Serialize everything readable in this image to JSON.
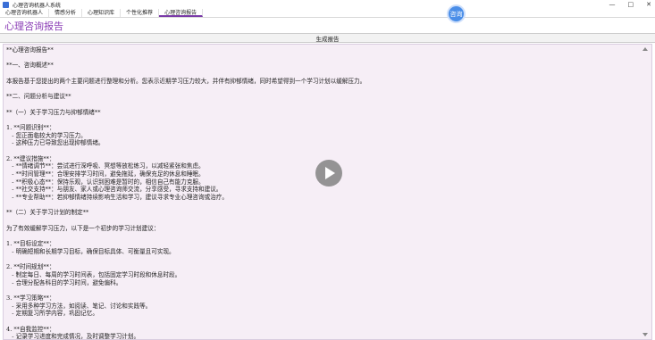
{
  "window": {
    "title": "心理咨询机器人系统",
    "controls": [
      "—",
      "□",
      "✕"
    ]
  },
  "menu": {
    "items": [
      "心理咨询机器人",
      "情感分析",
      "心理知识库",
      "个性化推荐",
      "心理咨询报告"
    ],
    "active_index": 4
  },
  "avatar": {
    "label": "咨询"
  },
  "page": {
    "title": "心理咨询报告"
  },
  "toolbar": {
    "generate_label": "生成报告"
  },
  "report": {
    "lines": [
      "**心理咨询报告**",
      "",
      "**一、咨询概述**",
      "",
      "本报告基于您提出的两个主要问题进行整理和分析。您表示近期学习压力较大，并伴有抑郁情绪，同时希望得到一个学习计划以缓解压力。",
      "",
      "**二、问题分析与建议**",
      "",
      "**（一）关于学习压力与抑郁情绪**",
      "",
      "1. **问题识别**：",
      "   - 您正面临较大的学习压力。",
      "   - 这种压力已导致您出现抑郁情绪。",
      "",
      "2. **建议措施**：",
      "   - **情绪调节**：尝试进行深呼吸、冥想等放松练习，以减轻紧张和焦虑。",
      "   - **时间管理**：合理安排学习时间，避免拖延，确保充足的休息和睡眠。",
      "   - **积极心态**：保持乐观，认识到困难是暂时的，相信自己有能力克服。",
      "   - **社交支持**：与朋友、家人或心理咨询师交流，分享感受，寻求支持和建议。",
      "   - **专业帮助**：若抑郁情绪持续影响生活和学习，建议寻求专业心理咨询或治疗。",
      "",
      "**（二）关于学习计划的制定**",
      "",
      "为了有效缓解学习压力，以下是一个初步的学习计划建议：",
      "",
      "1. **目标设定**：",
      "   - 明确短期和长期学习目标，确保目标具体、可衡量且可实现。",
      "",
      "2. **时间规划**：",
      "   - 制定每日、每周的学习时间表，包括固定学习时段和休息时段。",
      "   - 合理分配各科目的学习时间，避免偏科。",
      "",
      "3. **学习策略**：",
      "   - 采用多种学习方法，如阅读、笔记、讨论和实践等。",
      "   - 定期复习所学内容，巩固记忆。",
      "",
      "4. **自我监控**：",
      "   - 记录学习进度和完成情况，及时调整学习计划。"
    ]
  },
  "overlay": {
    "play_icon": "play-icon"
  }
}
